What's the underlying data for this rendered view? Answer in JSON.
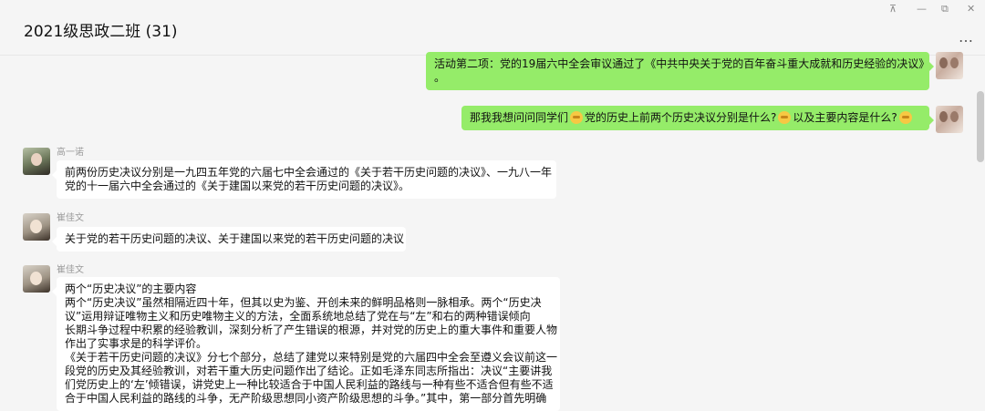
{
  "window": {
    "title": "2021级思政二班 (31)",
    "pin_glyph": "⊼",
    "minimize_glyph": "—",
    "restore_glyph": "⧉",
    "close_glyph": "✕",
    "more_glyph": "…"
  },
  "messages": {
    "m1": {
      "side": "right",
      "lines": [
        "活动第二项：党的19届六中全会审议通过了《中共中央关于党的百年奋斗重大成就和历史经验的决议》",
        "。"
      ]
    },
    "m2": {
      "side": "right",
      "seg1": "那我我想问问同学们",
      "seg2": "党的历史上前两个历史决议分别是什么?",
      "seg3": "以及主要内容是什么?"
    },
    "m3": {
      "side": "left",
      "sender": "高一诺",
      "lines": [
        "前两份历史决议分别是一九四五年党的六届七中全会通过的《关于若干历史问题的决议》、一九八一年",
        "党的十一届六中全会通过的《关于建国以来党的若干历史问题的决议》。"
      ]
    },
    "m4": {
      "side": "left",
      "sender": "崔佳文",
      "lines": [
        "关于党的若干历史问题的决议、关于建国以来党的若干历史问题的决议"
      ]
    },
    "m5": {
      "side": "left",
      "sender": "崔佳文",
      "lines": [
        "两个“历史决议”的主要内容",
        "两个“历史决议”虽然相隔近四十年，但其以史为鉴、开创未来的鲜明品格则一脉相承。两个“历史决",
        "议”运用辩证唯物主义和历史唯物主义的方法，全面系统地总结了党在与“左”和右的两种错误倾向",
        "长期斗争过程中积累的经验教训，深刻分析了产生错误的根源，并对党的历史上的重大事件和重要人物",
        "作出了实事求是的科学评价。",
        "《关于若干历史问题的决议》分七个部分，总结了建党以来特别是党的六届四中全会至遵义会议前这一",
        "段党的历史及其经验教训，对若干重大历史问题作出了结论。正如毛泽东同志所指出：决议“主要讲我",
        "们党历史上的‘左’倾错误，讲党史上一种比较适合于中国人民利益的路线与一种有些不适合但有些不适",
        "合于中国人民利益的路线的斗争，无产阶级思想同小资产阶级思想的斗争。”其中，第一部分首先明确"
      ]
    }
  }
}
